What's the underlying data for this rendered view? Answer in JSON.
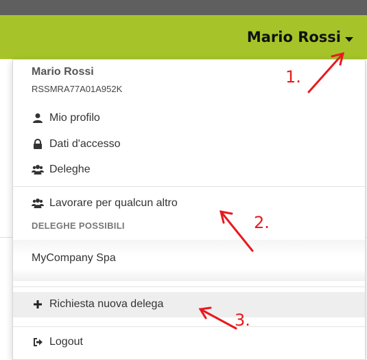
{
  "header": {
    "user_name": "Mario Rossi"
  },
  "dropdown": {
    "name": "Mario Rossi",
    "fiscal_code": "RSSMRA77A01A952K",
    "profile_items": [
      {
        "label": "Mio profilo",
        "icon": "user-icon"
      },
      {
        "label": "Dati d'accesso",
        "icon": "lock-icon"
      },
      {
        "label": "Deleghe",
        "icon": "users-icon"
      }
    ],
    "work_for_other_label": "Lavorare per qualcun altro",
    "possible_delegations_header": "DELEGHE POSSIBILI",
    "company_name": "MyCompany Spa",
    "new_delegation_label": "Richiesta nuova delega",
    "logout_label": "Logout"
  },
  "annotations": {
    "step1": "1.",
    "step2": "2.",
    "step3": "3."
  },
  "colors": {
    "header_green": "#a6c42a",
    "top_bar": "#5f5f5f",
    "annotation_red": "#e8191e"
  }
}
